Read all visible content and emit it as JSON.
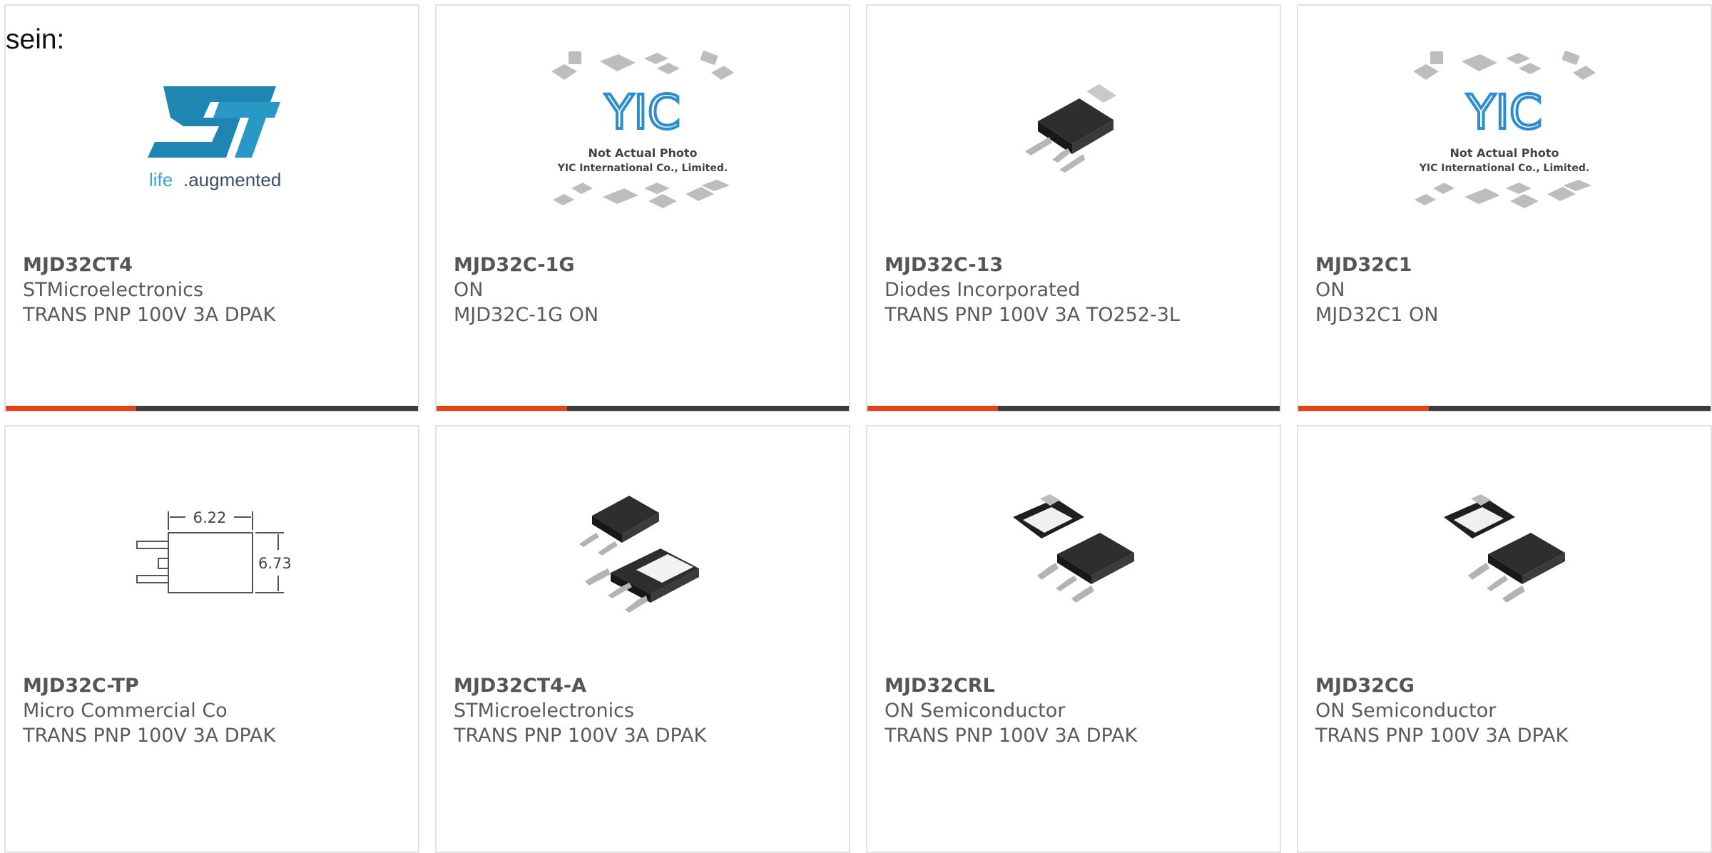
{
  "intro_text": "sein:",
  "products": [
    {
      "part": "MJD32CT4",
      "manufacturer": "STMicroelectronics",
      "description": "TRANS PNP 100V 3A DPAK",
      "image": "st-logo"
    },
    {
      "part": "MJD32C-1G",
      "manufacturer": "ON",
      "description": "MJD32C-1G ON",
      "image": "yic-placeholder"
    },
    {
      "part": "MJD32C-13",
      "manufacturer": "Diodes Incorporated",
      "description": "TRANS PNP 100V 3A TO252-3L",
      "image": "dpak-single"
    },
    {
      "part": "MJD32C1",
      "manufacturer": "ON",
      "description": "MJD32C1 ON",
      "image": "yic-placeholder"
    },
    {
      "part": "MJD32C-TP",
      "manufacturer": "Micro Commercial Co",
      "description": "TRANS PNP 100V 3A DPAK",
      "image": "dimension-drawing"
    },
    {
      "part": "MJD32CT4-A",
      "manufacturer": "STMicroelectronics",
      "description": "TRANS PNP 100V 3A DPAK",
      "image": "dpak-pair-vertical"
    },
    {
      "part": "MJD32CRL",
      "manufacturer": "ON Semiconductor",
      "description": "TRANS PNP 100V 3A DPAK",
      "image": "dpak-pair"
    },
    {
      "part": "MJD32CG",
      "manufacturer": "ON Semiconductor",
      "description": "TRANS PNP 100V 3A DPAK",
      "image": "dpak-pair"
    }
  ],
  "images": {
    "st_logo_tagline_a": "life",
    "st_logo_tagline_b": ".augmented",
    "yic_brand": "YIC",
    "yic_caption_1": "Not Actual Photo",
    "yic_caption_2": "YIC International Co., Limited.",
    "dimension_width": "6.22",
    "dimension_height": "6.73"
  },
  "colors": {
    "accent": "#e24317",
    "bar_dark": "#3c3c3c",
    "card_border": "#e2e2e2",
    "text": "#5a5a5a",
    "st_blue": "#1f86b4",
    "yic_blue": "#2d8ecf"
  }
}
